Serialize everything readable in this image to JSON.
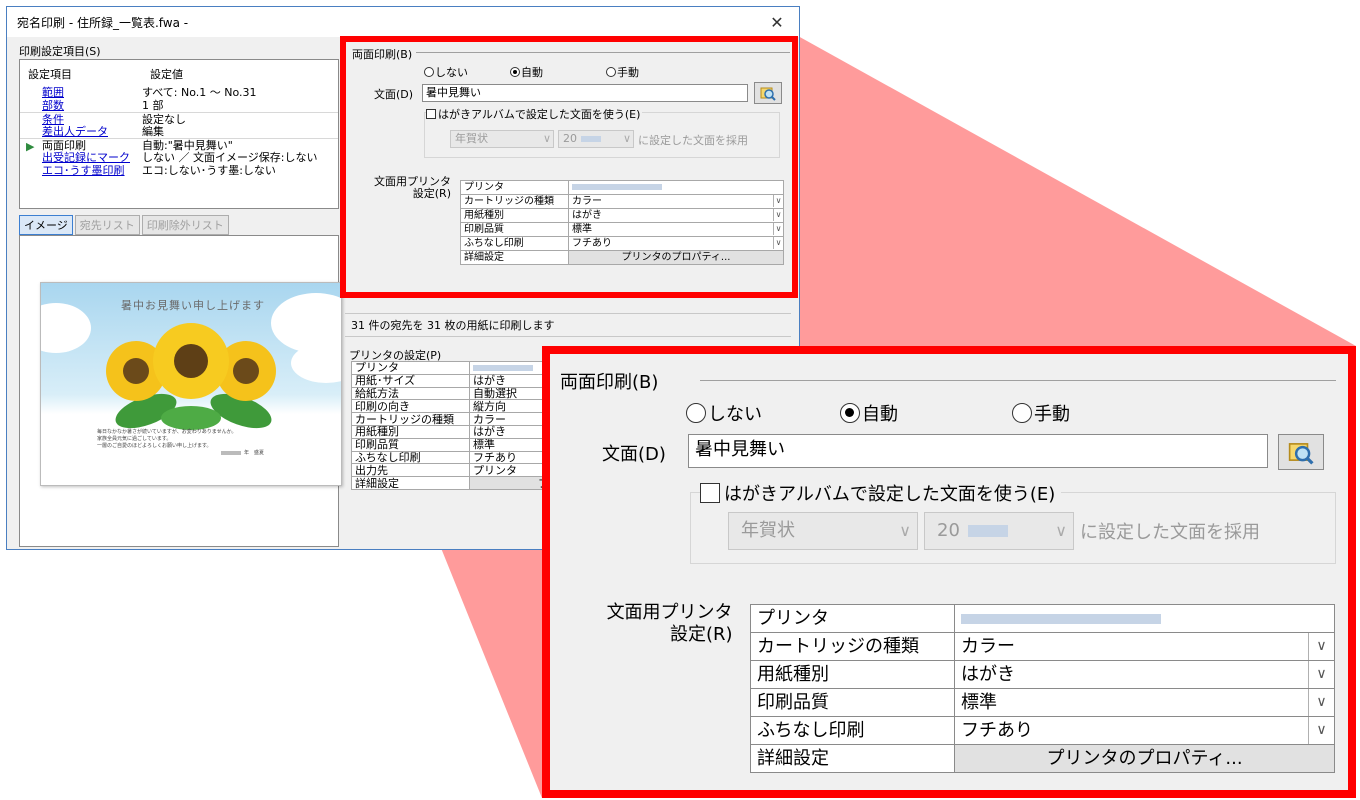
{
  "window": {
    "title": "宛名印刷 - 住所録_一覧表.fwa -",
    "close_glyph": "✕"
  },
  "settings": {
    "section_label": "印刷設定項目(S)",
    "col_item": "設定項目",
    "col_value": "設定値",
    "rows": [
      {
        "label": "範囲",
        "value": "すべて: No.1 〜 No.31"
      },
      {
        "label": "部数",
        "value": "1 部"
      },
      {
        "label": "条件",
        "value": "設定なし"
      },
      {
        "label": "差出人データ",
        "value": "編集"
      },
      {
        "label": "両面印刷",
        "value": "自動:\"暑中見舞い\""
      },
      {
        "label": "出受記録にマーク",
        "value": "しない ／ 文面イメージ保存:しない"
      },
      {
        "label": "エコ･うす墨印刷",
        "value": "エコ:しない･うす墨:しない"
      }
    ],
    "current_marker": "▶"
  },
  "tabs": [
    "イメージ",
    "宛先リスト",
    "印刷除外リスト"
  ],
  "preview": {
    "greeting": "暑中お見舞い申し上げます",
    "message_lines": [
      "毎日なかなか暑さが続いていますが、お変わりありませんか。",
      "家族全員元気に過ごしています。",
      "一層のご自愛のほどよろしくお願い申し上げます。"
    ],
    "sender_suffix": "年　盛夏"
  },
  "summary": {
    "count_text": "31 件の宛先を 31 枚の用紙に印刷します",
    "printer_settings_label": "プリンタの設定(P)",
    "printer_settings": [
      {
        "label": "プリンタ",
        "value": ""
      },
      {
        "label": "用紙･サイズ",
        "value": "はがき"
      },
      {
        "label": "給紙方法",
        "value": "自動選択"
      },
      {
        "label": "印刷の向き",
        "value": "縦方向"
      },
      {
        "label": "カートリッジの種類",
        "value": "カラー"
      },
      {
        "label": "用紙種別",
        "value": "はがき"
      },
      {
        "label": "印刷品質",
        "value": "標準"
      },
      {
        "label": "ふちなし印刷",
        "value": "フチあり"
      },
      {
        "label": "出力先",
        "value": "プリンタ"
      },
      {
        "label": "詳細設定",
        "value": "プリンタ"
      }
    ]
  },
  "duplex": {
    "title": "両面印刷(B)",
    "options": [
      "しない",
      "自動",
      "手動"
    ],
    "selected": "自動",
    "text_label": "文面(D)",
    "text_value": "暑中見舞い",
    "album_checkbox": "はがきアルバムで設定した文面を使う(E)",
    "card_type": "年賀状",
    "year_prefix": "20",
    "adopt_text": "に設定した文面を採用",
    "printer_label_1": "文面用プリンタ",
    "printer_label_2": "設定(R)",
    "grid": [
      {
        "label": "プリンタ",
        "value": "",
        "dropdown": false
      },
      {
        "label": "カートリッジの種類",
        "value": "カラー",
        "dropdown": true
      },
      {
        "label": "用紙種別",
        "value": "はがき",
        "dropdown": true
      },
      {
        "label": "印刷品質",
        "value": "標準",
        "dropdown": true
      },
      {
        "label": "ふちなし印刷",
        "value": "フチあり",
        "dropdown": true
      }
    ],
    "detail_label": "詳細設定",
    "properties_button": "プリンタのプロパティ..."
  },
  "icons": {
    "search_icon": "magnifier-icon",
    "chevron": "chevron-down-icon"
  },
  "colors": {
    "highlight": "#ff0000",
    "zoom_fill": "#ff7a7a",
    "link": "#0000cc",
    "marker": "#2e8b3e"
  }
}
